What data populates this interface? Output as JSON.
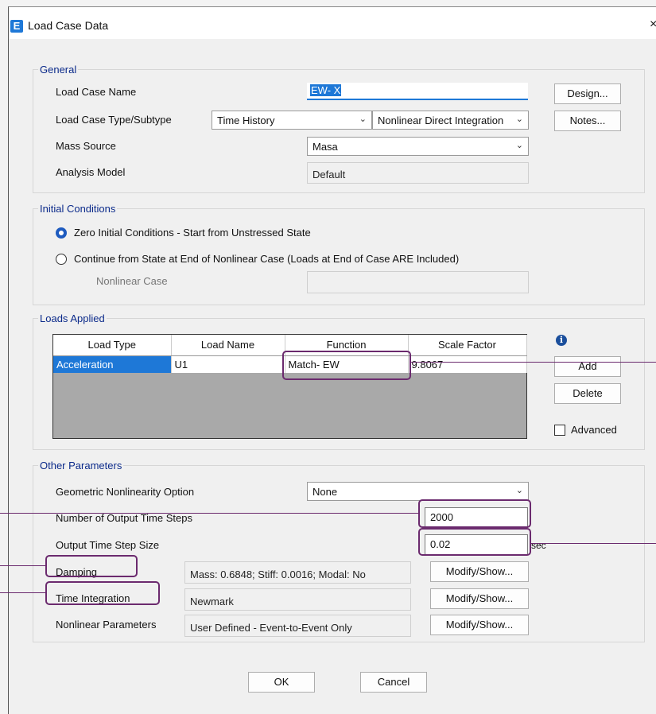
{
  "window": {
    "title": "Load Case Data",
    "app_icon_letter": "E",
    "close_symbol": "×"
  },
  "general": {
    "legend": "General",
    "load_case_name_label": "Load Case Name",
    "load_case_name_value": "EW- X",
    "type_label": "Load Case Type/Subtype",
    "type_value": "Time History",
    "subtype_value": "Nonlinear Direct Integration",
    "mass_source_label": "Mass Source",
    "mass_source_value": "Masa",
    "analysis_model_label": "Analysis Model",
    "analysis_model_value": "Default",
    "design_button": "Design...",
    "notes_button": "Notes..."
  },
  "initial": {
    "legend": "Initial Conditions",
    "option_zero": "Zero Initial Conditions - Start from Unstressed State",
    "option_continue": "Continue from State at End of Nonlinear Case  (Loads at End of Case ARE Included)",
    "nonlinear_case_label": "Nonlinear Case",
    "nonlinear_case_value": "",
    "selected": "zero"
  },
  "loads": {
    "legend": "Loads Applied",
    "columns": [
      "Load Type",
      "Load Name",
      "Function",
      "Scale Factor"
    ],
    "rows": [
      {
        "load_type": "Acceleration",
        "load_name": "U1",
        "function": "Match- EW",
        "scale_factor": "9.8067"
      }
    ],
    "add_button": "Add",
    "delete_button": "Delete",
    "advanced_label": "Advanced",
    "advanced_checked": false,
    "info_icon": "i"
  },
  "other": {
    "legend": "Other Parameters",
    "geo_label": "Geometric Nonlinearity Option",
    "geo_value": "None",
    "steps_label": "Number of Output Time Steps",
    "steps_value": "2000",
    "step_size_label": "Output Time Step Size",
    "step_size_value": "0.02",
    "step_size_unit": "sec",
    "damping_label": "Damping",
    "damping_value": "Mass: 0.6848; Stiff: 0.0016; Modal: No",
    "integration_label": "Time Integration",
    "integration_value": "Newmark",
    "nonlinear_params_label": "Nonlinear Parameters",
    "nonlinear_params_value": "User Defined - Event-to-Event Only",
    "modify_button": "Modify/Show..."
  },
  "footer": {
    "ok_button": "OK",
    "cancel_button": "Cancel"
  },
  "colors": {
    "accent": "#1e78d7",
    "annotation": "#6b2a6e",
    "legend_text": "#0b2a8a"
  }
}
